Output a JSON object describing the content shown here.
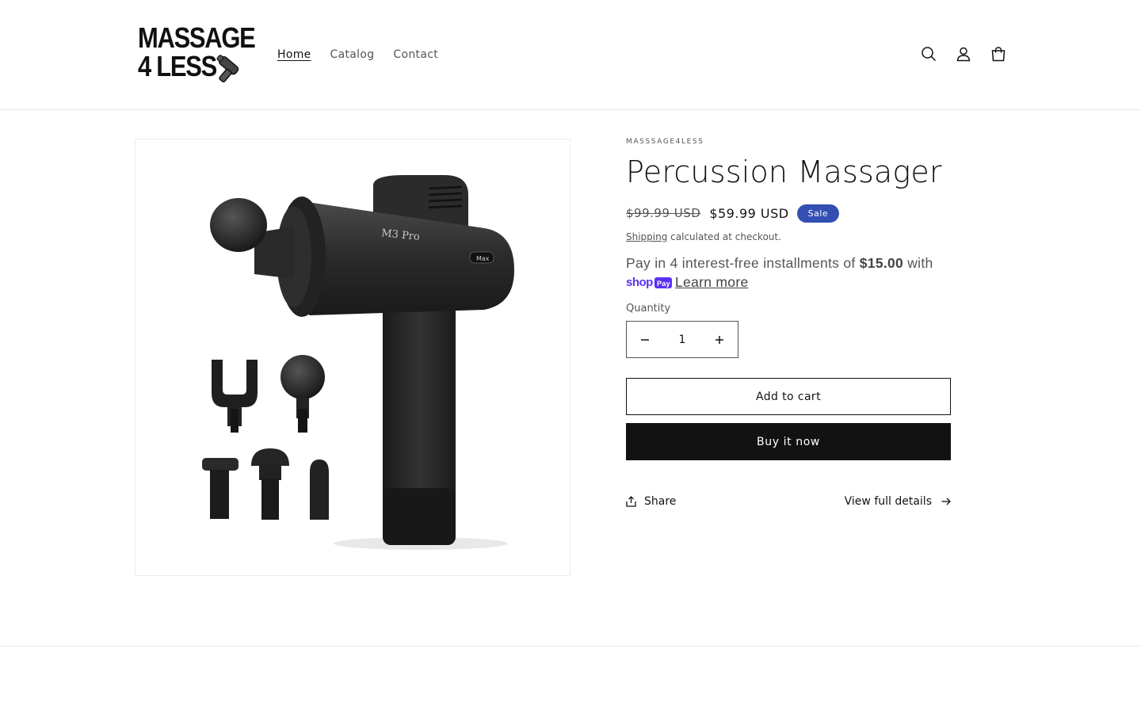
{
  "header": {
    "logo": {
      "line1": "MASSAGE",
      "line2": "4 LESS"
    },
    "nav": [
      {
        "label": "Home",
        "active": true
      },
      {
        "label": "Catalog",
        "active": false
      },
      {
        "label": "Contact",
        "active": false
      }
    ],
    "icons": [
      "search-icon",
      "account-icon",
      "cart-icon"
    ]
  },
  "product": {
    "vendor": "MASSSAGE4LESS",
    "title": "Percussion Massager",
    "price_compare": "$99.99 USD",
    "price_sale": "$59.99 USD",
    "badge": "Sale",
    "shipping_link": "Shipping",
    "shipping_note": " calculated at checkout.",
    "image_label": "M3 Pro",
    "image_badge": "Max",
    "installments": {
      "prefix": "Pay in 4 interest-free installments of ",
      "amount": "$15.00",
      "suffix": " with",
      "brand": "shop",
      "brand_pay": "Pay",
      "learn_more": "Learn more"
    },
    "quantity_label": "Quantity",
    "quantity_value": "1",
    "add_to_cart": "Add to cart",
    "buy_now": "Buy it now",
    "share": "Share",
    "view_details": "View full details"
  },
  "colors": {
    "sale_badge": "#334fb4",
    "shoppay": "#5a31f4",
    "primary": "#121212"
  }
}
